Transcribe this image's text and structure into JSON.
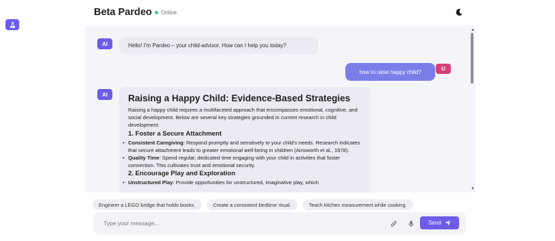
{
  "header": {
    "title": "Beta Pardeo",
    "status": "Online"
  },
  "icons": {
    "left_button": "flask-icon",
    "theme": "moon-icon",
    "attach": "paperclip-icon",
    "mic": "microphone-icon",
    "send": "paper-plane-icon"
  },
  "colors": {
    "accent": "#6d5ce8",
    "user_bubble": "#7b7ee9",
    "user_avatar": "#d6407a",
    "online": "#4fbf74"
  },
  "messages": {
    "ai_avatar": "AI",
    "user_avatar": "U",
    "greeting": "Hello! I'm Pardeo – your child-advisor. How can I help you today?",
    "user_question": "how to raise happy child?",
    "response": {
      "title": "Raising a Happy Child: Evidence-Based Strategies",
      "intro": "Raising a happy child requires a multifaceted approach that encompasses emotional, cognitive, and social development. Below are several key strategies grounded in current research in child development.",
      "section1_heading": "1. Foster a Secure Attachment",
      "section1_items": [
        {
          "term": "Consistent Caregiving",
          "text": ": Respond promptly and sensitively to your child's needs. Research indicates that secure attachment leads to greater emotional well-being in children (Ainsworth et al., 1978)."
        },
        {
          "term": "Quality Time",
          "text": ": Spend regular, dedicated time engaging with your child in activities that foster connection. This cultivates trust and emotional security."
        }
      ],
      "section2_heading": "2. Encourage Play and Exploration",
      "section2_items": [
        {
          "term": "Unstructured Play",
          "text": ": Provide opportunities for unstructured, imaginative play, which"
        }
      ]
    }
  },
  "suggestions": [
    "Engineer a LEGO bridge that holds books.",
    "Create a consistent bedtime ritual.",
    "Teach kitchen measurement while cooking."
  ],
  "composer": {
    "placeholder": "Type your message...",
    "send_label": "Send"
  }
}
